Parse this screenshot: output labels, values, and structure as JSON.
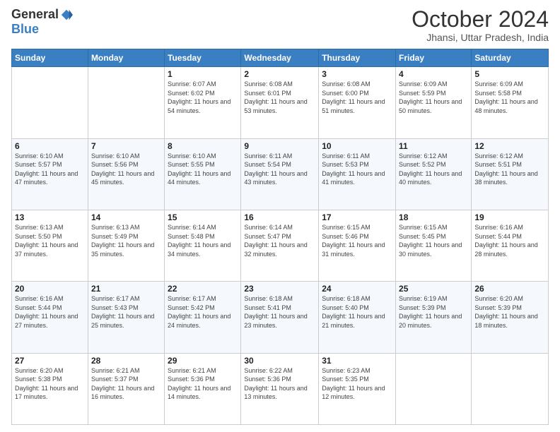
{
  "header": {
    "logo_general": "General",
    "logo_blue": "Blue",
    "month_title": "October 2024",
    "subtitle": "Jhansi, Uttar Pradesh, India"
  },
  "weekdays": [
    "Sunday",
    "Monday",
    "Tuesday",
    "Wednesday",
    "Thursday",
    "Friday",
    "Saturday"
  ],
  "weeks": [
    [
      {
        "day": null
      },
      {
        "day": null
      },
      {
        "day": "1",
        "sunrise": "6:07 AM",
        "sunset": "6:02 PM",
        "daylight": "11 hours and 54 minutes."
      },
      {
        "day": "2",
        "sunrise": "6:08 AM",
        "sunset": "6:01 PM",
        "daylight": "11 hours and 53 minutes."
      },
      {
        "day": "3",
        "sunrise": "6:08 AM",
        "sunset": "6:00 PM",
        "daylight": "11 hours and 51 minutes."
      },
      {
        "day": "4",
        "sunrise": "6:09 AM",
        "sunset": "5:59 PM",
        "daylight": "11 hours and 50 minutes."
      },
      {
        "day": "5",
        "sunrise": "6:09 AM",
        "sunset": "5:58 PM",
        "daylight": "11 hours and 48 minutes."
      }
    ],
    [
      {
        "day": "6",
        "sunrise": "6:10 AM",
        "sunset": "5:57 PM",
        "daylight": "11 hours and 47 minutes."
      },
      {
        "day": "7",
        "sunrise": "6:10 AM",
        "sunset": "5:56 PM",
        "daylight": "11 hours and 45 minutes."
      },
      {
        "day": "8",
        "sunrise": "6:10 AM",
        "sunset": "5:55 PM",
        "daylight": "11 hours and 44 minutes."
      },
      {
        "day": "9",
        "sunrise": "6:11 AM",
        "sunset": "5:54 PM",
        "daylight": "11 hours and 43 minutes."
      },
      {
        "day": "10",
        "sunrise": "6:11 AM",
        "sunset": "5:53 PM",
        "daylight": "11 hours and 41 minutes."
      },
      {
        "day": "11",
        "sunrise": "6:12 AM",
        "sunset": "5:52 PM",
        "daylight": "11 hours and 40 minutes."
      },
      {
        "day": "12",
        "sunrise": "6:12 AM",
        "sunset": "5:51 PM",
        "daylight": "11 hours and 38 minutes."
      }
    ],
    [
      {
        "day": "13",
        "sunrise": "6:13 AM",
        "sunset": "5:50 PM",
        "daylight": "11 hours and 37 minutes."
      },
      {
        "day": "14",
        "sunrise": "6:13 AM",
        "sunset": "5:49 PM",
        "daylight": "11 hours and 35 minutes."
      },
      {
        "day": "15",
        "sunrise": "6:14 AM",
        "sunset": "5:48 PM",
        "daylight": "11 hours and 34 minutes."
      },
      {
        "day": "16",
        "sunrise": "6:14 AM",
        "sunset": "5:47 PM",
        "daylight": "11 hours and 32 minutes."
      },
      {
        "day": "17",
        "sunrise": "6:15 AM",
        "sunset": "5:46 PM",
        "daylight": "11 hours and 31 minutes."
      },
      {
        "day": "18",
        "sunrise": "6:15 AM",
        "sunset": "5:45 PM",
        "daylight": "11 hours and 30 minutes."
      },
      {
        "day": "19",
        "sunrise": "6:16 AM",
        "sunset": "5:44 PM",
        "daylight": "11 hours and 28 minutes."
      }
    ],
    [
      {
        "day": "20",
        "sunrise": "6:16 AM",
        "sunset": "5:44 PM",
        "daylight": "11 hours and 27 minutes."
      },
      {
        "day": "21",
        "sunrise": "6:17 AM",
        "sunset": "5:43 PM",
        "daylight": "11 hours and 25 minutes."
      },
      {
        "day": "22",
        "sunrise": "6:17 AM",
        "sunset": "5:42 PM",
        "daylight": "11 hours and 24 minutes."
      },
      {
        "day": "23",
        "sunrise": "6:18 AM",
        "sunset": "5:41 PM",
        "daylight": "11 hours and 23 minutes."
      },
      {
        "day": "24",
        "sunrise": "6:18 AM",
        "sunset": "5:40 PM",
        "daylight": "11 hours and 21 minutes."
      },
      {
        "day": "25",
        "sunrise": "6:19 AM",
        "sunset": "5:39 PM",
        "daylight": "11 hours and 20 minutes."
      },
      {
        "day": "26",
        "sunrise": "6:20 AM",
        "sunset": "5:39 PM",
        "daylight": "11 hours and 18 minutes."
      }
    ],
    [
      {
        "day": "27",
        "sunrise": "6:20 AM",
        "sunset": "5:38 PM",
        "daylight": "11 hours and 17 minutes."
      },
      {
        "day": "28",
        "sunrise": "6:21 AM",
        "sunset": "5:37 PM",
        "daylight": "11 hours and 16 minutes."
      },
      {
        "day": "29",
        "sunrise": "6:21 AM",
        "sunset": "5:36 PM",
        "daylight": "11 hours and 14 minutes."
      },
      {
        "day": "30",
        "sunrise": "6:22 AM",
        "sunset": "5:36 PM",
        "daylight": "11 hours and 13 minutes."
      },
      {
        "day": "31",
        "sunrise": "6:23 AM",
        "sunset": "5:35 PM",
        "daylight": "11 hours and 12 minutes."
      },
      {
        "day": null
      },
      {
        "day": null
      }
    ]
  ]
}
